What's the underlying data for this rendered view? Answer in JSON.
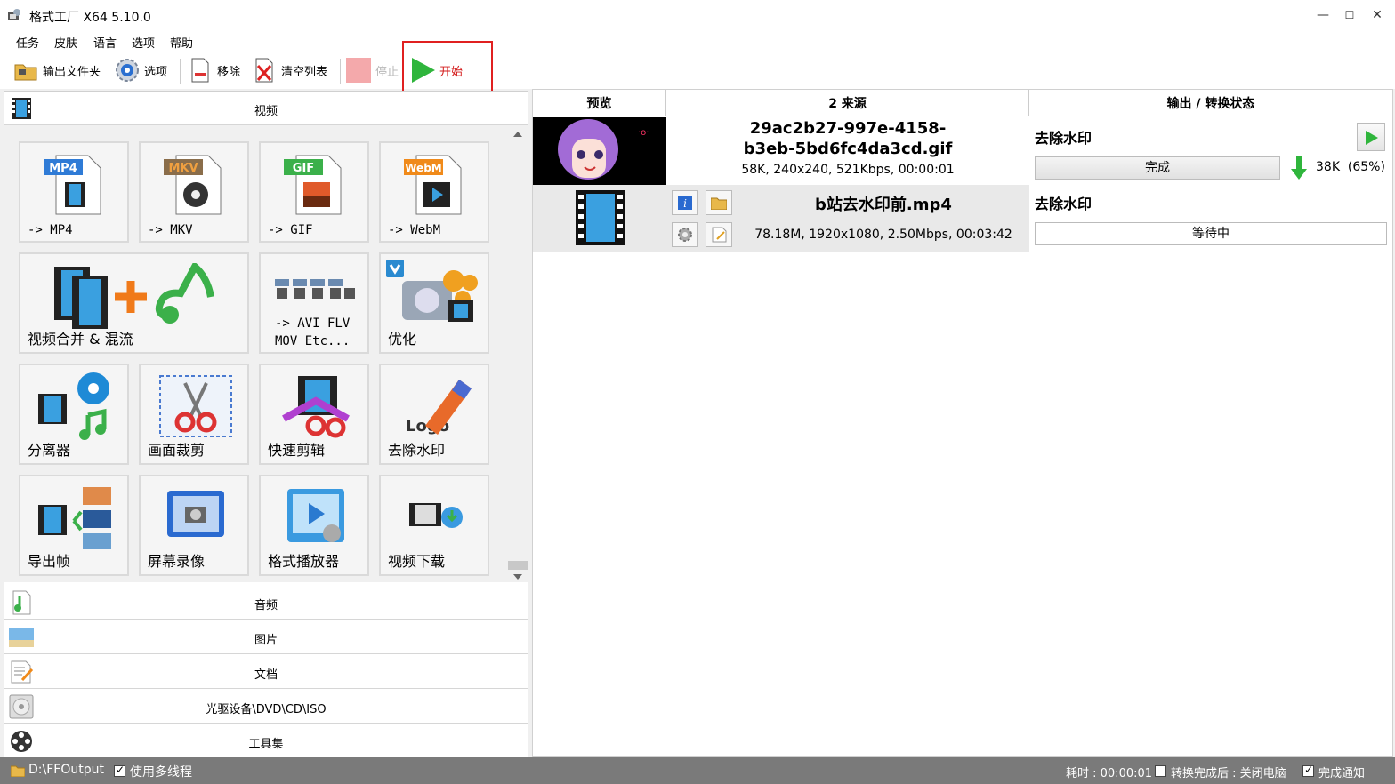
{
  "window": {
    "title": "格式工厂 X64 5.10.0",
    "controls": {
      "minimize": "—",
      "maximize": "☐",
      "close": "✕"
    }
  },
  "menu": [
    "任务",
    "皮肤",
    "语言",
    "选项",
    "帮助"
  ],
  "toolbar": {
    "output_folder": "输出文件夹",
    "options": "选项",
    "remove": "移除",
    "clear_list": "清空列表",
    "stop": "停止",
    "start": "开始"
  },
  "categories": {
    "video": "视频",
    "audio": "音频",
    "image": "图片",
    "document": "文档",
    "disc": "光驱设备\\DVD\\CD\\ISO",
    "tools": "工具集"
  },
  "tiles": [
    {
      "label": "-> MP4",
      "badge": "MP4"
    },
    {
      "label": "-> MKV",
      "badge": "MKV"
    },
    {
      "label": "-> GIF",
      "badge": "GIF"
    },
    {
      "label": "-> WebM",
      "badge": "WebM"
    },
    {
      "label": "视频合并 & 混流"
    },
    {
      "label": "-> AVI FLV",
      "label2": "MOV Etc..."
    },
    {
      "label": "优化"
    },
    {
      "label": "分离器"
    },
    {
      "label": "画面裁剪"
    },
    {
      "label": "快速剪辑"
    },
    {
      "label": "去除水印",
      "logo_text": "Logo"
    },
    {
      "label": "导出帧"
    },
    {
      "label": "屏幕录像"
    },
    {
      "label": "格式播放器"
    },
    {
      "label": "视频下载"
    }
  ],
  "task_table": {
    "headers": {
      "preview": "预览",
      "source": "2 来源",
      "output": "输出 / 转换状态"
    },
    "rows": [
      {
        "name_line1": "29ac2b27-997e-4158-",
        "name_line2": "b3eb-5bd6fc4da3cd.gif",
        "info": "58K, 240x240, 521Kbps, 00:00:01",
        "action": "去除水印",
        "status": "完成",
        "size_result": "38K  (65%)",
        "progress": 1.0
      },
      {
        "name_line1": "b站去水印前.mp4",
        "info": "78.18M, 1920x1080, 2.50Mbps, 00:03:42",
        "action": "去除水印",
        "status": "等待中"
      }
    ]
  },
  "status_bar": {
    "output_path": "D:\\FFOutput",
    "multithread": "使用多线程",
    "elapsed": "耗时 : 00:00:01",
    "after_convert": "转换完成后 : 关闭电脑",
    "notify": "完成通知"
  },
  "colors": {
    "accent_red": "#e02020",
    "play_green": "#2fb53c",
    "progress_gray": "#e3e3e3"
  }
}
